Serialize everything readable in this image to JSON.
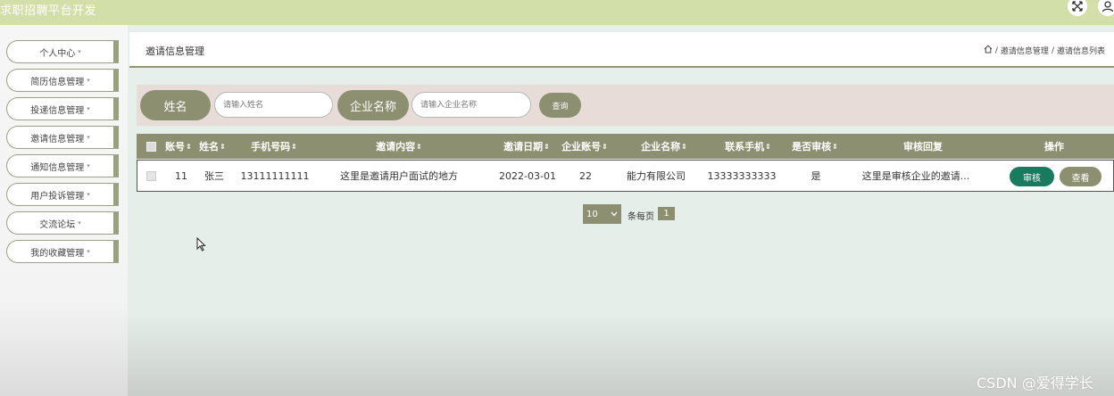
{
  "app": {
    "title": "求职招聘平台开发"
  },
  "topbar": {
    "fullscreen_icon": "fullscreen-icon",
    "user_icon": "user-icon"
  },
  "sidebar": {
    "items": [
      {
        "label": "个人中心"
      },
      {
        "label": "简历信息管理"
      },
      {
        "label": "投递信息管理"
      },
      {
        "label": "邀请信息管理"
      },
      {
        "label": "通知信息管理"
      },
      {
        "label": "用户投诉管理"
      },
      {
        "label": "交流论坛"
      },
      {
        "label": "我的收藏管理"
      }
    ],
    "caret": "▾"
  },
  "header": {
    "title": "邀请信息管理",
    "breadcrumb": [
      "邀请信息管理",
      "邀请信息列表"
    ],
    "separator": "/"
  },
  "search": {
    "name_label": "姓名",
    "name_placeholder": "请输入姓名",
    "company_label": "企业名称",
    "company_placeholder": "请输入企业名称",
    "query_button": "查询"
  },
  "table": {
    "sort_icon": "⇕",
    "columns": [
      "账号",
      "姓名",
      "手机号码",
      "邀请内容",
      "邀请日期",
      "企业账号",
      "企业名称",
      "联系手机",
      "是否审核",
      "审核回复",
      "操作"
    ],
    "rows": [
      {
        "account": "11",
        "name": "张三",
        "phone": "13111111111",
        "content": "这里是邀请用户面试的地方",
        "date": "2022-03-01",
        "company_account": "22",
        "company_name": "能力有限公司",
        "contact": "13333333333",
        "reviewed": "是",
        "reply": "这里是审核企业的邀请...",
        "actions": {
          "audit": "审核",
          "view": "查看"
        }
      }
    ]
  },
  "pagination": {
    "page_size": "10",
    "per_page_label": "条每页",
    "current_page": "1"
  },
  "watermark": "CSDN @爱得学长",
  "colors": {
    "olive": "#8d9070",
    "green": "#1a7a5e",
    "topbar": "#d3dfa8"
  }
}
